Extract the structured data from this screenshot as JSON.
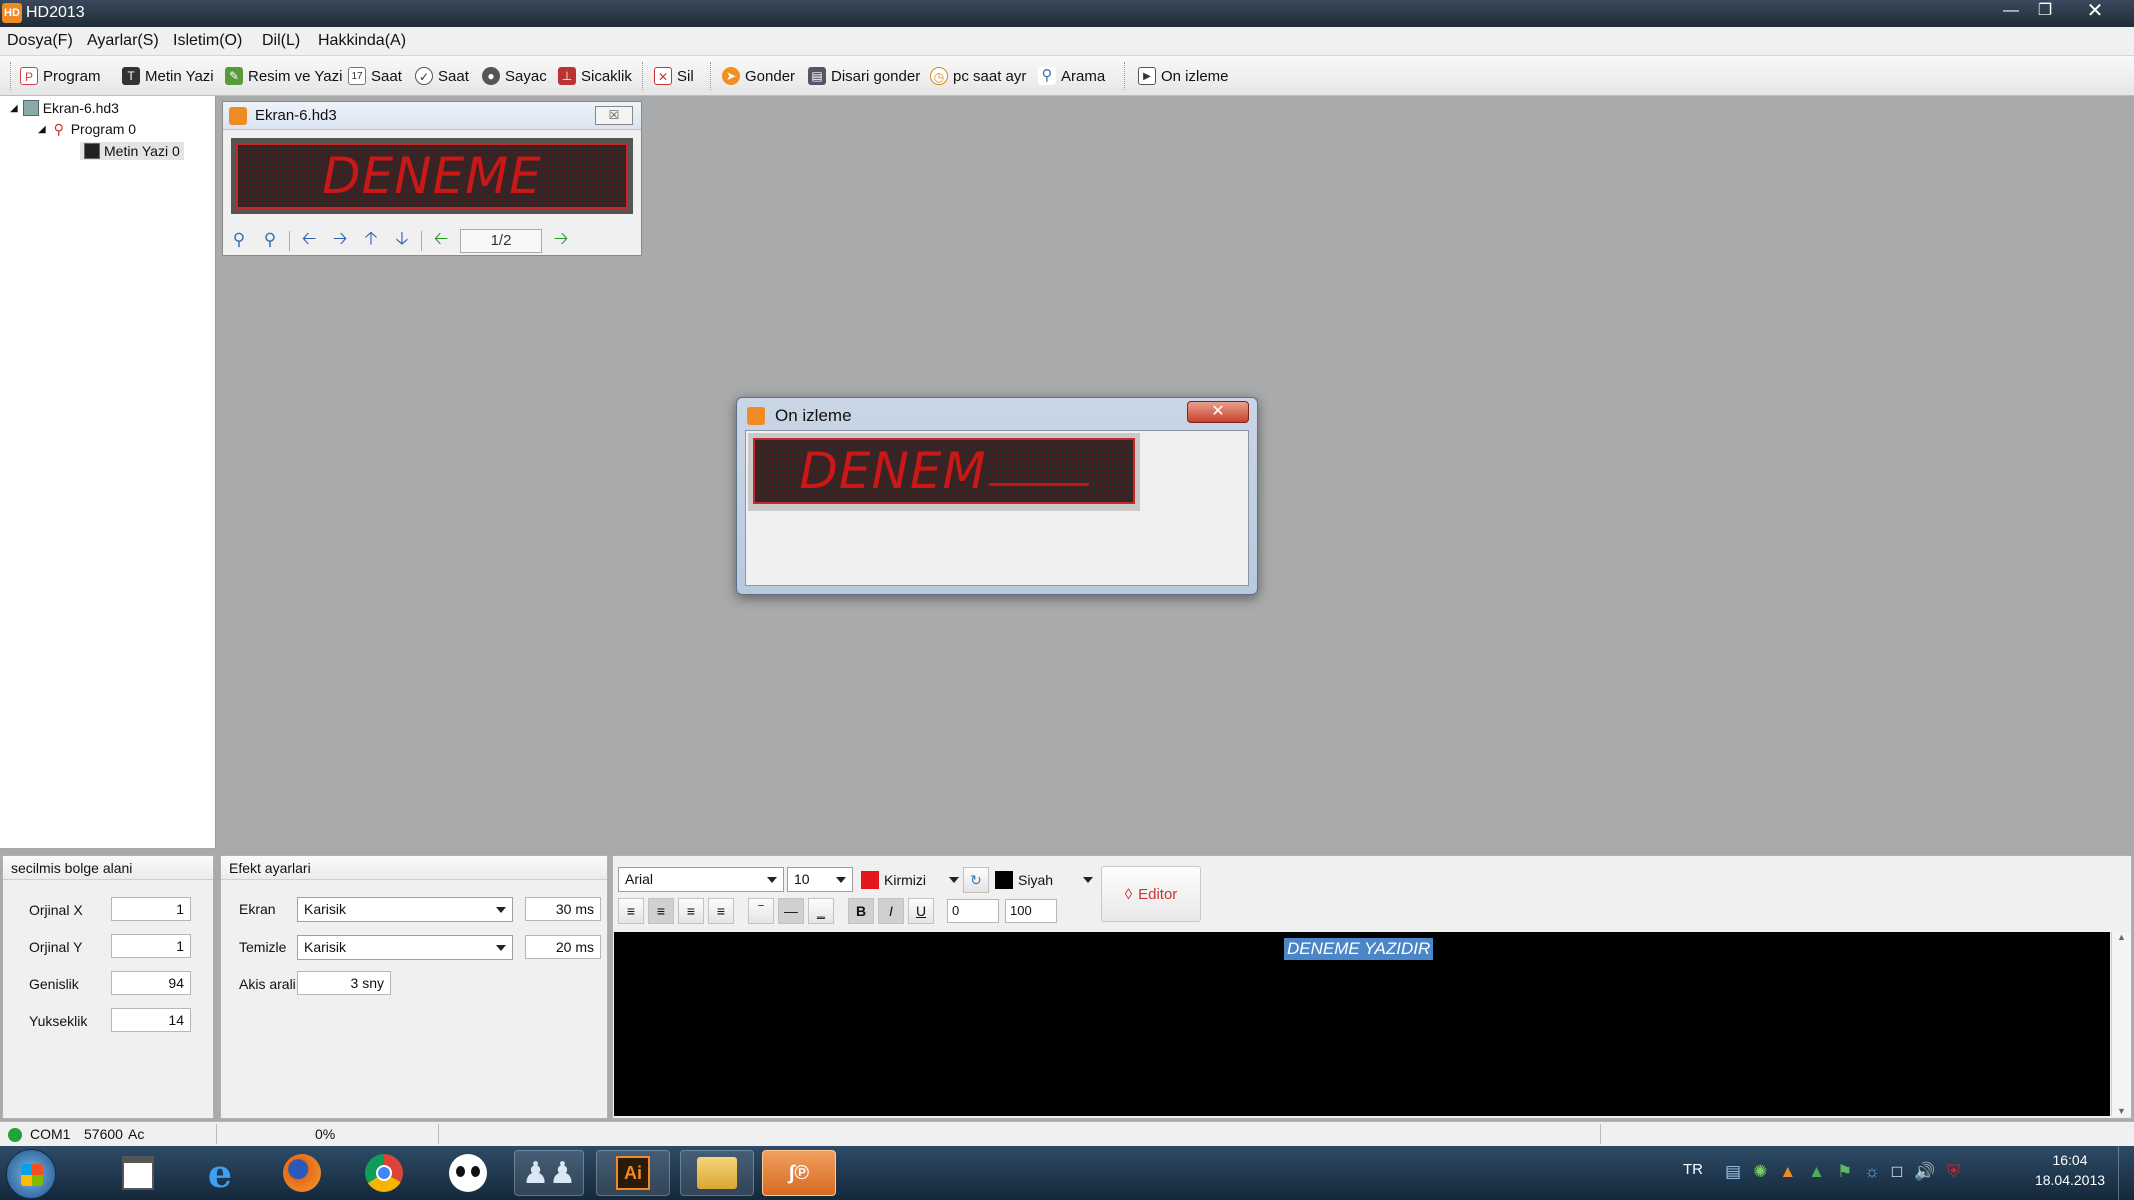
{
  "window": {
    "title": "HD2013"
  },
  "menu": [
    "Dosya(F)",
    "Ayarlar(S)",
    "Isletim(O)",
    "Dil(L)",
    "Hakkinda(A)"
  ],
  "toolbar": {
    "program": "Program",
    "metin_yazi": "Metin Yazi",
    "resim_ve_yazi": "Resim ve Yazi",
    "saat1": "Saat",
    "saat2": "Saat",
    "sayac": "Sayac",
    "sicaklik": "Sicaklik",
    "sil": "Sil",
    "gonder": "Gonder",
    "disari_gonder": "Disari gonder",
    "pc_saat": "pc saat ayr",
    "arama": "Arama",
    "on_izleme": "On izleme"
  },
  "tree": {
    "root": "Ekran-6.hd3",
    "program": "Program 0",
    "item": "Metin Yazi 0"
  },
  "child_window": {
    "title": "Ekran-6.hd3",
    "led_text": "DENEME",
    "page": "1/2"
  },
  "preview_dialog": {
    "title": "On izleme",
    "led_text": "DENEM"
  },
  "region_panel": {
    "title": "secilmis bolge alani",
    "fields": [
      {
        "label": "Orjinal X",
        "value": "1"
      },
      {
        "label": "Orjinal Y",
        "value": "1"
      },
      {
        "label": "Genislik",
        "value": "94"
      },
      {
        "label": "Yukseklik",
        "value": "14"
      }
    ]
  },
  "effect_panel": {
    "title": "Efekt ayarlari",
    "ekran_label": "Ekran",
    "ekran_value": "Karisik",
    "ekran_ms": "30 ms",
    "temizle_label": "Temizle",
    "temizle_value": "Karisik",
    "temizle_ms": "20 ms",
    "akis_label": "Akis arali",
    "akis_value": "3 sny"
  },
  "editor": {
    "font": "Arial",
    "size": "10",
    "fg_color_name": "Kirmizi",
    "bg_color_name": "Siyah",
    "editor_button": "Editor",
    "spin1": "0",
    "spin2": "100",
    "text": "DENEME YAZIDIR",
    "fg_color": "#e3161b",
    "bg_color": "#000000"
  },
  "status": {
    "port": "COM1",
    "baud": "57600",
    "state": "Ac",
    "progress": "0%"
  },
  "taskbar": {
    "lang": "TR",
    "time": "16:04",
    "date": "18.04.2013",
    "ai_label": "Ai"
  }
}
